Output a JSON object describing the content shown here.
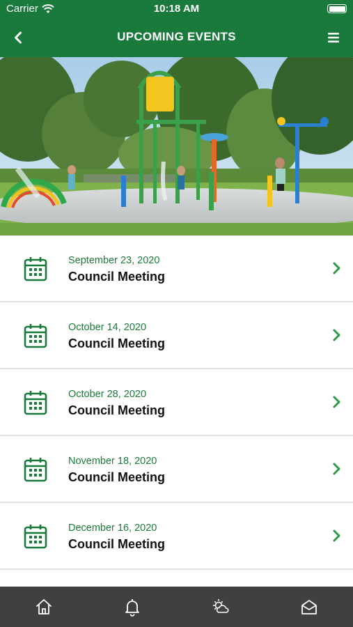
{
  "status_bar": {
    "carrier": "Carrier",
    "time": "10:18 AM"
  },
  "header": {
    "title": "UPCOMING EVENTS",
    "back_icon": "chevron-left-icon",
    "menu_icon": "hamburger-menu-icon"
  },
  "hero": {
    "image": "splash-pad-park-photo"
  },
  "events": [
    {
      "date": "September 23, 2020",
      "name": "Council Meeting"
    },
    {
      "date": "October 14, 2020",
      "name": "Council Meeting"
    },
    {
      "date": "October 28, 2020",
      "name": "Council Meeting"
    },
    {
      "date": "November 18, 2020",
      "name": "Council Meeting"
    },
    {
      "date": "December 16, 2020",
      "name": "Council Meeting"
    }
  ],
  "tab_bar": {
    "tabs": [
      {
        "icon": "home-icon"
      },
      {
        "icon": "bell-icon"
      },
      {
        "icon": "weather-icon"
      },
      {
        "icon": "mail-icon"
      }
    ]
  },
  "colors": {
    "brand_green": "#1a7a3b",
    "accent_green": "#2e9a3f",
    "tab_bar": "#404040"
  }
}
